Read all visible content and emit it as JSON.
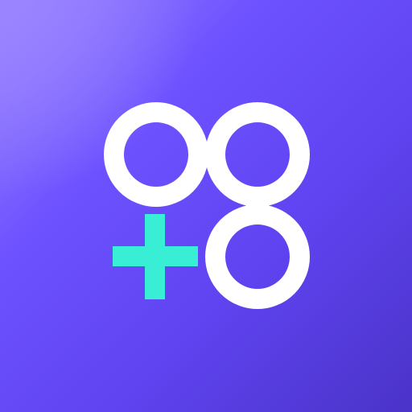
{
  "icon": {
    "colors": {
      "background_top_left": "#9a84ff",
      "background_main": "#6d52ff",
      "background_bottom_right": "#4a33c8",
      "rings": "#ffffff",
      "plus": "#38efd6"
    },
    "symbols": [
      "circle-icon",
      "circle-icon",
      "circle-icon",
      "plus-icon"
    ]
  }
}
